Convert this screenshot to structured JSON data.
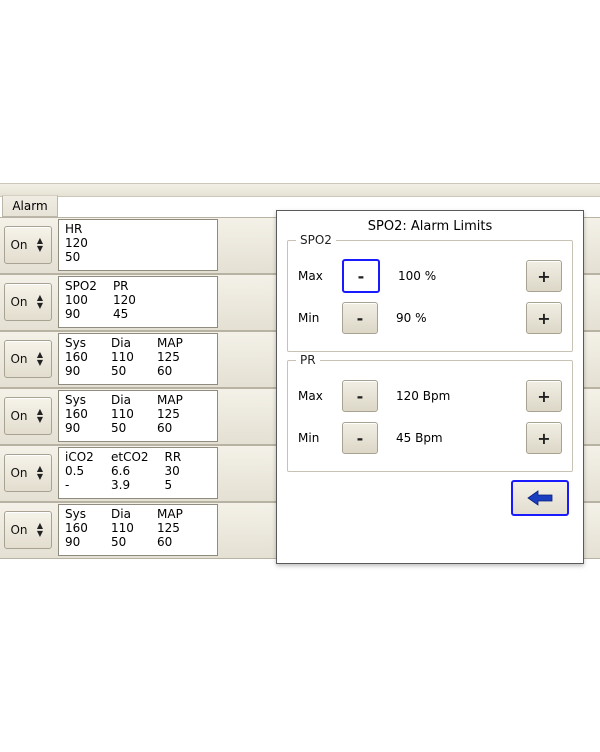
{
  "header": {
    "alarm_col": "Alarm"
  },
  "on_label": "On",
  "rows": [
    {
      "cols": [
        {
          "h": "HR",
          "a": "120",
          "b": "50"
        }
      ]
    },
    {
      "cols": [
        {
          "h": "SPO2",
          "a": "100",
          "b": "90"
        },
        {
          "h": "PR",
          "a": "120",
          "b": "45"
        }
      ]
    },
    {
      "cols": [
        {
          "h": "Sys",
          "a": "160",
          "b": "90"
        },
        {
          "h": "Dia",
          "a": "110",
          "b": "50"
        },
        {
          "h": "MAP",
          "a": "125",
          "b": "60"
        }
      ]
    },
    {
      "cols": [
        {
          "h": "Sys",
          "a": "160",
          "b": "90"
        },
        {
          "h": "Dia",
          "a": "110",
          "b": "50"
        },
        {
          "h": "MAP",
          "a": "125",
          "b": "60"
        }
      ]
    },
    {
      "cols": [
        {
          "h": "iCO2",
          "a": "0.5",
          "b": "-"
        },
        {
          "h": "etCO2",
          "a": "6.6",
          "b": "3.9"
        },
        {
          "h": "RR",
          "a": "30",
          "b": "5"
        }
      ]
    },
    {
      "cols": [
        {
          "h": "Sys",
          "a": "160",
          "b": "90"
        },
        {
          "h": "Dia",
          "a": "110",
          "b": "50"
        },
        {
          "h": "MAP",
          "a": "125",
          "b": "60"
        }
      ]
    }
  ],
  "dialog": {
    "title": "SPO2: Alarm Limits",
    "groups": [
      {
        "legend": "SPO2",
        "max_label": "Max",
        "max_value": "100 %",
        "min_label": "Min",
        "min_value": "90 %",
        "focus_minus_max": true
      },
      {
        "legend": "PR",
        "max_label": "Max",
        "max_value": "120 Bpm",
        "min_label": "Min",
        "min_value": "45 Bpm",
        "focus_minus_max": false
      }
    ],
    "minus": "-",
    "plus": "+"
  }
}
